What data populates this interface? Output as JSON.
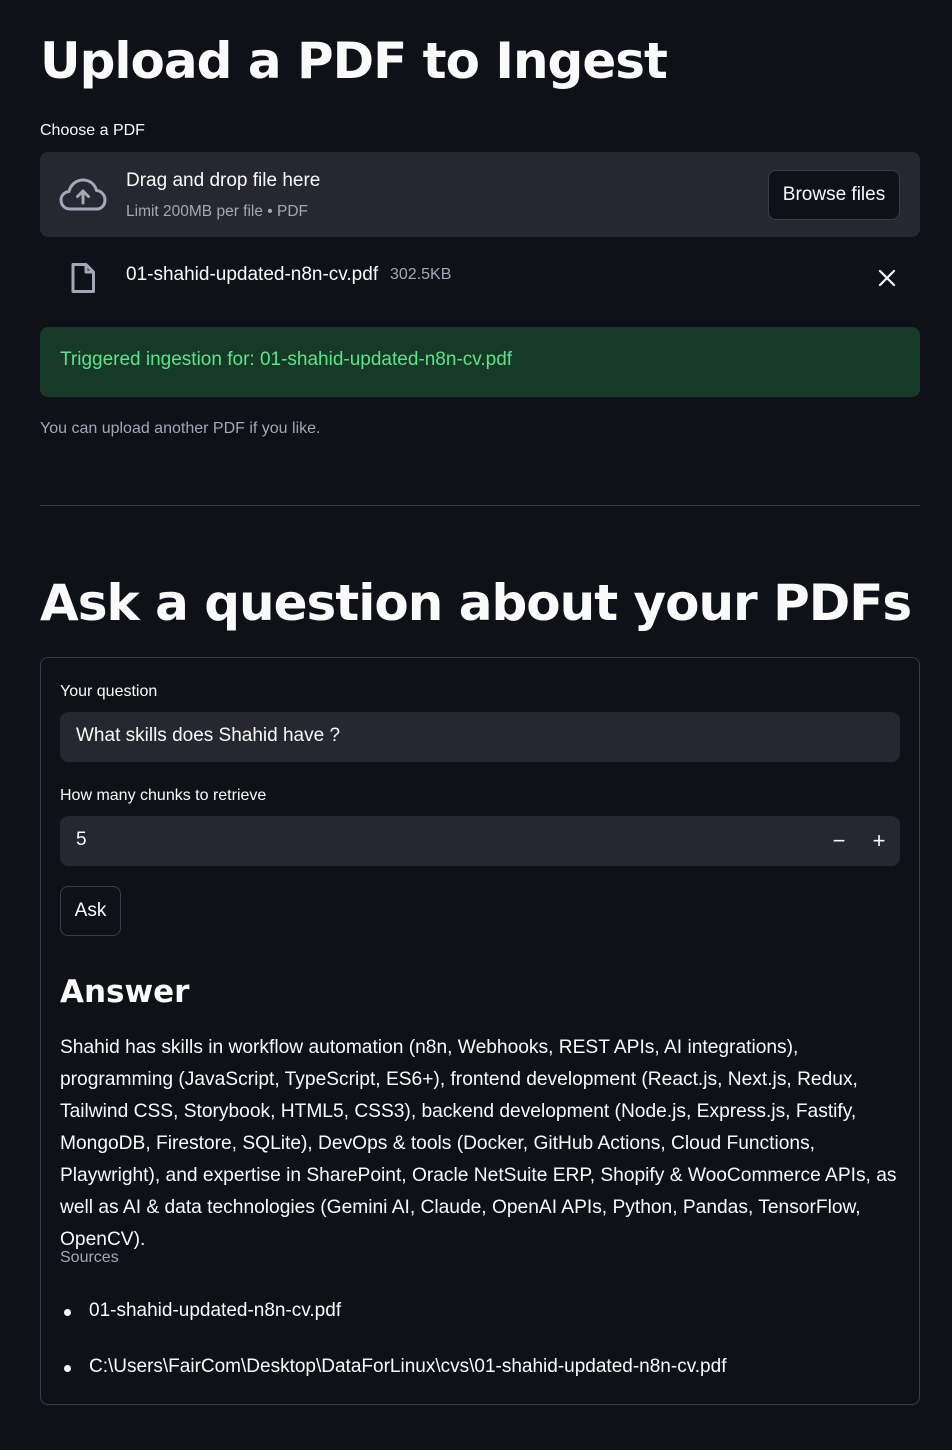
{
  "upload": {
    "title": "Upload a PDF to Ingest",
    "label": "Choose a PDF",
    "dropzone_main": "Drag and drop file here",
    "dropzone_sub": "Limit 200MB per file • PDF",
    "browse_label": "Browse files",
    "file_name": "01-shahid-updated-n8n-cv.pdf",
    "file_size": "302.5KB",
    "success_message": "Triggered ingestion for: 01-shahid-updated-n8n-cv.pdf",
    "caption": "You can upload another PDF if you like."
  },
  "ask": {
    "title": "Ask a question about your PDFs",
    "question_label": "Your question",
    "question_value": "What skills does Shahid have ?",
    "chunks_label": "How many chunks to retrieve",
    "chunks_value": "5",
    "minus_label": "−",
    "plus_label": "+",
    "ask_label": "Ask"
  },
  "answer": {
    "heading": "Answer",
    "text": "Shahid has skills in workflow automation (n8n, Webhooks, REST APIs, AI integrations), programming (JavaScript, TypeScript, ES6+), frontend development (React.js, Next.js, Redux, Tailwind CSS, Storybook, HTML5, CSS3), backend development (Node.js, Express.js, Fastify, MongoDB, Firestore, SQLite), DevOps & tools (Docker, GitHub Actions, Cloud Functions, Playwright), and expertise in SharePoint, Oracle NetSuite ERP, Shopify & WooCommerce APIs, as well as AI & data technologies (Gemini AI, Claude, OpenAI APIs, Python, Pandas, TensorFlow, OpenCV).",
    "sources_label": "Sources",
    "sources": [
      "01-shahid-updated-n8n-cv.pdf",
      "C:\\Users\\FairCom\\Desktop\\DataForLinux\\cvs\\01-shahid-updated-n8n-cv.pdf"
    ]
  },
  "colors": {
    "background": "#0e1117",
    "surface": "#262730",
    "success_bg": "#173928",
    "success_text": "#5ce488",
    "muted_text": "#a3a8b8"
  },
  "icons": {
    "upload": "cloud-upload-icon",
    "file": "file-icon",
    "remove": "close-icon"
  }
}
